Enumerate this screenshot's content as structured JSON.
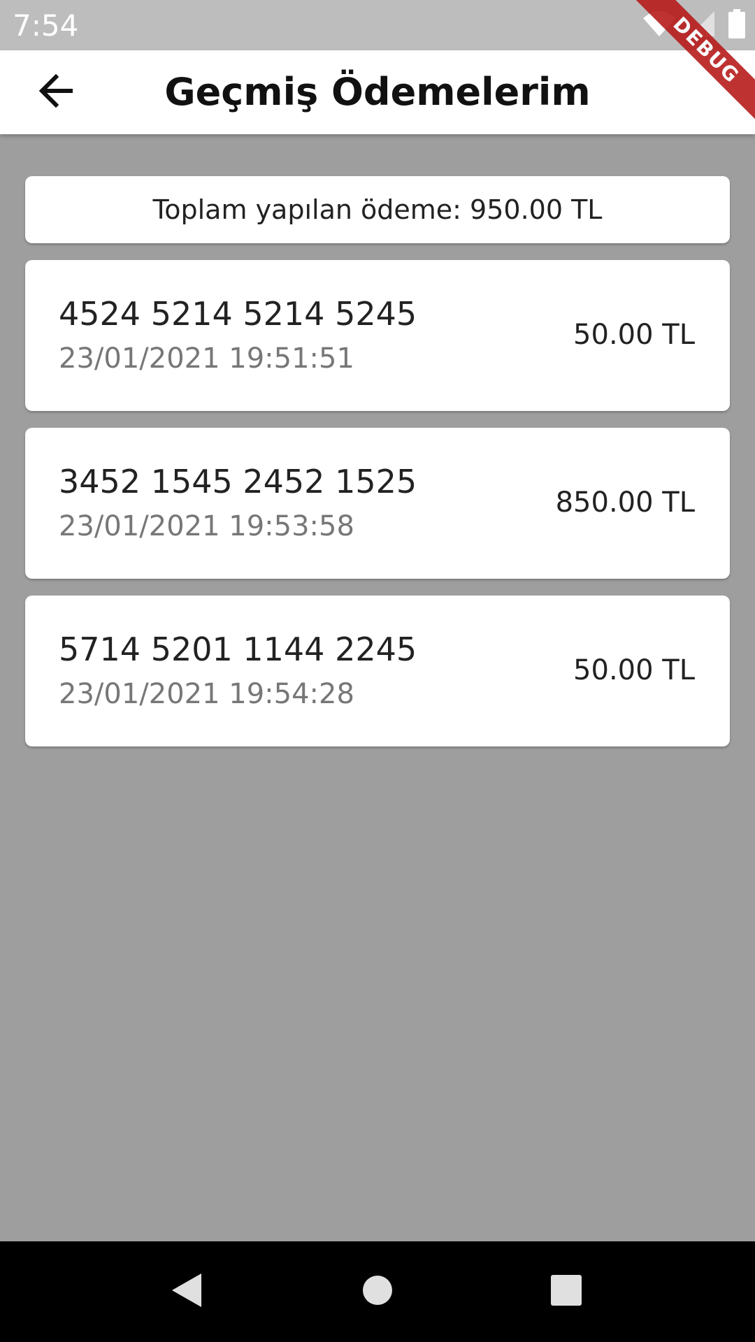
{
  "status_bar": {
    "time": "7:54"
  },
  "debug_banner": {
    "label": "DEBUG"
  },
  "app_bar": {
    "title": "Geçmiş Ödemelerim",
    "back_icon": "arrow-back-icon"
  },
  "summary": {
    "total_text": "Toplam yapılan ödeme: 950.00 TL"
  },
  "payments": [
    {
      "card_number": "4524 5214 5214 5245",
      "date": "23/01/2021 19:51:51",
      "amount": "50.00 TL"
    },
    {
      "card_number": "3452 1545 2452 1525",
      "date": "23/01/2021 19:53:58",
      "amount": "850.00 TL"
    },
    {
      "card_number": "5714 5201 1144 2245",
      "date": "23/01/2021 19:54:28",
      "amount": "50.00 TL"
    }
  ],
  "colors": {
    "background": "#9e9e9e",
    "status_bar": "#bdbdbd",
    "card": "#ffffff",
    "debug": "#b71c1c",
    "nav_bar": "#000000"
  }
}
